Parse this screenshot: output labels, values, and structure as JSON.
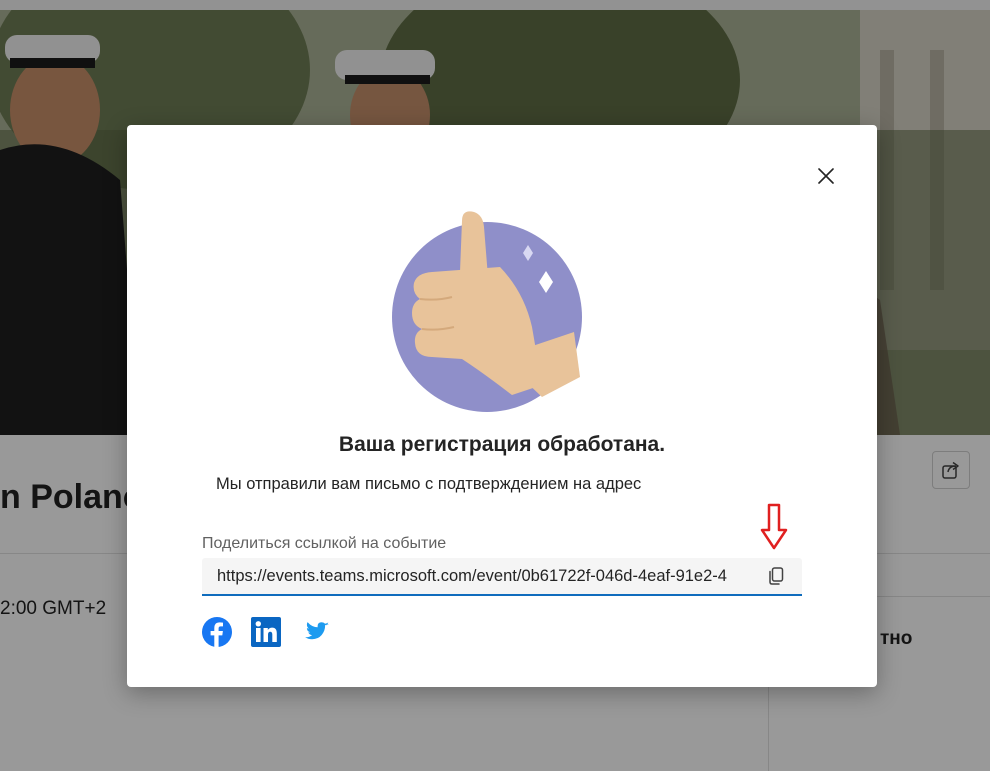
{
  "background_page": {
    "event_title": "n Polano",
    "event_time": "2:00 GMT+2",
    "side_label": "тно"
  },
  "dialog": {
    "title": "Ваша регистрация обработана.",
    "message": "Мы отправили вам письмо с подтверждением на адрес",
    "share_label": "Поделиться ссылкой на событие",
    "share_url": "https://events.teams.microsoft.com/event/0b61722f-046d-4eaf-91e2-4",
    "social": [
      "facebook",
      "linkedin",
      "twitter"
    ]
  },
  "colors": {
    "accent": "#0f6cbd",
    "illustration_circle": "#8f8fc9",
    "hand": "#e8c39a",
    "annotation_arrow": "#e02020",
    "facebook": "#1877f2",
    "linkedin": "#0a66c2",
    "twitter": "#1d9bf0"
  },
  "icons": [
    "close-icon",
    "thumbs-up-illustration",
    "copy-icon",
    "share-icon",
    "down-arrow-annotation",
    "facebook-icon",
    "linkedin-icon",
    "twitter-icon"
  ]
}
